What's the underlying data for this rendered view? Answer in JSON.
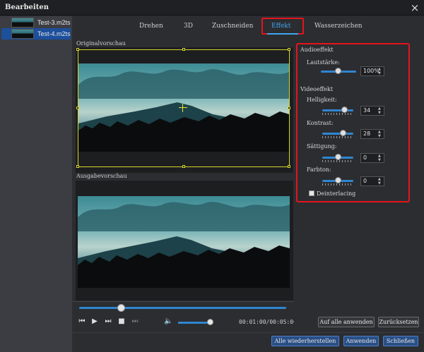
{
  "window": {
    "title": "Bearbeiten",
    "close_glyph": "×"
  },
  "files": [
    {
      "name": "Test-3.m2ts",
      "selected": false
    },
    {
      "name": "Test-4.m2ts",
      "selected": true
    }
  ],
  "tabs": [
    "Drehen",
    "3D",
    "Zuschneiden",
    "Effekt",
    "Wasserzeichen"
  ],
  "active_tab": "Effekt",
  "preview": {
    "original_label": "Originalvorschau",
    "output_label": "Ausgabevorschau"
  },
  "player": {
    "timecode": "00:01:00/00:05:00",
    "seek_fraction": 0.2,
    "volume_fraction": 0.85
  },
  "effects": {
    "audio_group": "Audioeffekt",
    "volume_label": "Lautstärke:",
    "volume_value": "100%",
    "video_group": "Videoeffekt",
    "brightness_label": "Helligkeit:",
    "brightness_value": "34",
    "contrast_label": "Kontrast:",
    "contrast_value": "28",
    "saturation_label": "Sättigung:",
    "saturation_value": "0",
    "hue_label": "Farbton:",
    "hue_value": "0",
    "deinterlacing_label": "Deinterlacing"
  },
  "buttons": {
    "apply_all": "Auf alle anwenden",
    "reset": "Zurücksetzen",
    "restore_all": "Alle wiederherstellen",
    "apply": "Anwenden",
    "close": "Schließen"
  },
  "icons": [
    "prev-frame-icon",
    "play-icon",
    "next-icon",
    "stop-icon",
    "end-icon",
    "volume-icon"
  ],
  "colors": {
    "accent": "#2f86d0",
    "highlight": "#e5141d",
    "selection": "#1c4f9c",
    "active_tab": "#3fa6f0"
  }
}
